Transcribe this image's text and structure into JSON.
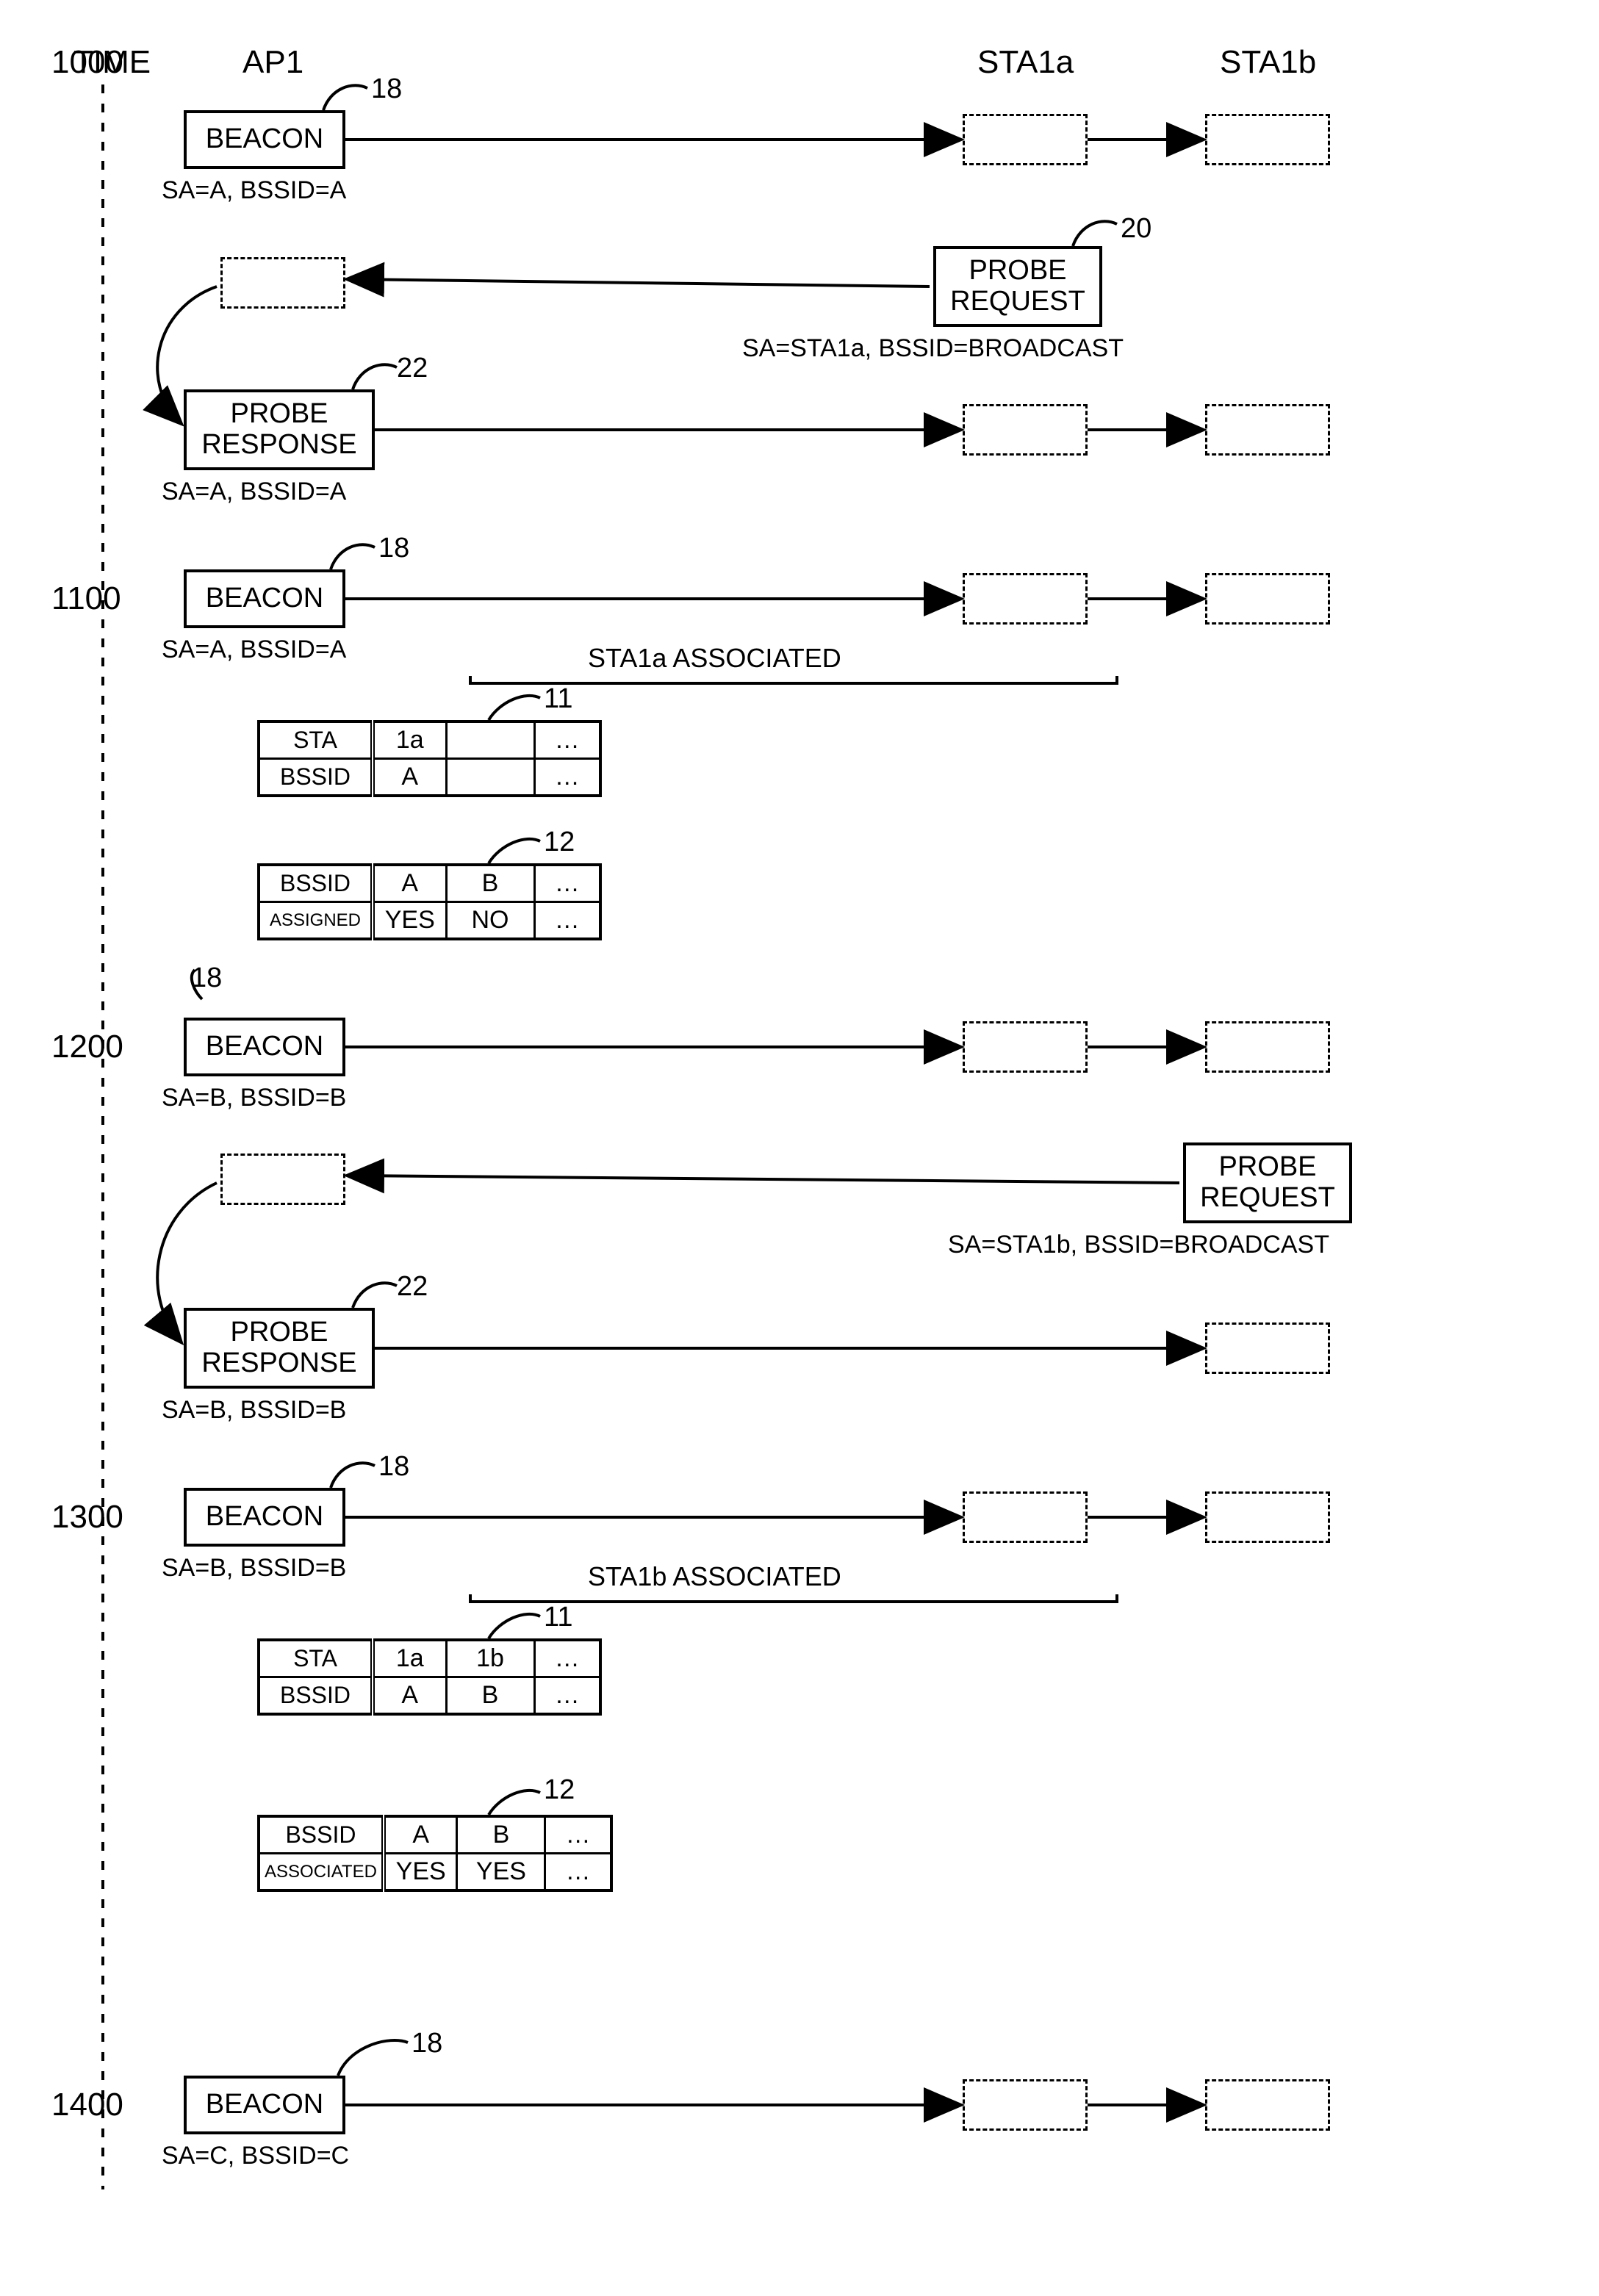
{
  "headers": {
    "time": "TIME",
    "ap1": "AP1",
    "sta1a": "STA1a",
    "sta1b": "STA1b"
  },
  "time_ticks": {
    "t1": "1000",
    "t2": "1100",
    "t3": "1200",
    "t4": "1300",
    "t5": "1400"
  },
  "boxes": {
    "beacon": "BEACON",
    "probe_request_l1": "PROBE",
    "probe_request_l2": "REQUEST",
    "probe_response_l1": "PROBE",
    "probe_response_l2": "RESPONSE"
  },
  "subs": {
    "sa_a": "SA=A, BSSID=A",
    "sa_b": "SA=B, BSSID=B",
    "sa_c": "SA=C, BSSID=C",
    "sa_sta1a": "SA=STA1a, BSSID=BROADCAST",
    "sa_sta1b": "SA=STA1b, BSSID=BROADCAST"
  },
  "callouts": {
    "c18": "18",
    "c20": "20",
    "c22": "22",
    "c11": "11",
    "c12": "12"
  },
  "assoc": {
    "sta1a": "STA1a  ASSOCIATED",
    "sta1b": "STA1b  ASSOCIATED"
  },
  "table11_a": {
    "r1": {
      "label": "STA",
      "c1": "1a",
      "c2": "",
      "c3": "…"
    },
    "r2": {
      "label": "BSSID",
      "c1": "A",
      "c2": "",
      "c3": "…"
    }
  },
  "table12_a": {
    "r1": {
      "label": "BSSID",
      "c1": "A",
      "c2": "B",
      "c3": "…"
    },
    "r2": {
      "label": "ASSIGNED",
      "c1": "YES",
      "c2": "NO",
      "c3": "…"
    }
  },
  "table11_b": {
    "r1": {
      "label": "STA",
      "c1": "1a",
      "c2": "1b",
      "c3": "…"
    },
    "r2": {
      "label": "BSSID",
      "c1": "A",
      "c2": "B",
      "c3": "…"
    }
  },
  "table12_b": {
    "r1": {
      "label": "BSSID",
      "c1": "A",
      "c2": "B",
      "c3": "…"
    },
    "r2": {
      "label": "ASSOCIATED",
      "c1": "YES",
      "c2": "YES",
      "c3": "…"
    }
  }
}
